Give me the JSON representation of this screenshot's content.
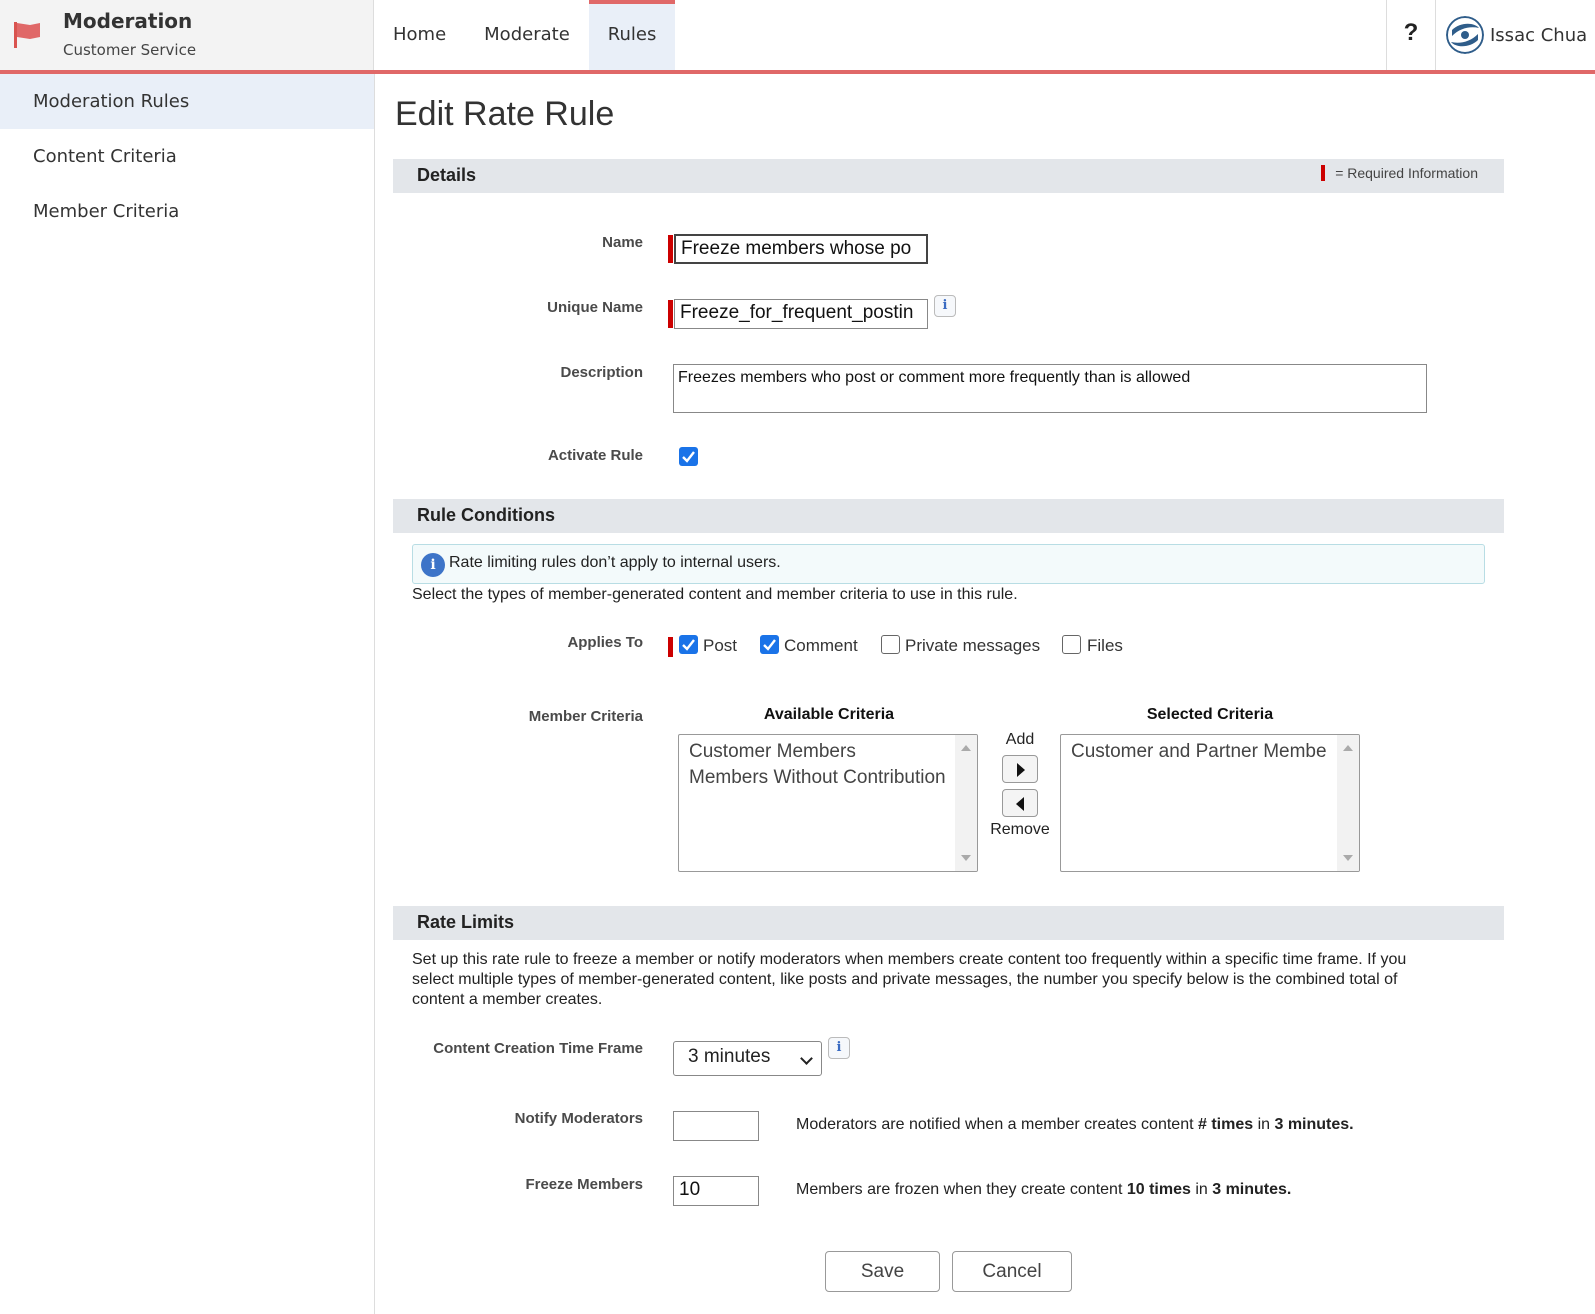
{
  "app": {
    "title": "Moderation",
    "subtitle": "Customer Service"
  },
  "nav": {
    "tabs": [
      {
        "label": "Home"
      },
      {
        "label": "Moderate"
      },
      {
        "label": "Rules",
        "active": true
      }
    ]
  },
  "help_label": "?",
  "user": {
    "name": "Issac Chua"
  },
  "sidebar": {
    "items": [
      {
        "label": "Moderation Rules",
        "active": true
      },
      {
        "label": "Content Criteria"
      },
      {
        "label": "Member Criteria"
      }
    ]
  },
  "page": {
    "title": "Edit Rate Rule"
  },
  "details": {
    "heading": "Details",
    "required_legend": "= Required Information",
    "name_label": "Name",
    "name_value": "Freeze members whose po",
    "unique_name_label": "Unique Name",
    "unique_name_value": "Freeze_for_frequent_postin",
    "description_label": "Description",
    "description_value": "Freezes members who post or comment more frequently than is allowed",
    "activate_label": "Activate Rule",
    "activate_checked": true
  },
  "conditions": {
    "heading": "Rule Conditions",
    "notice": "Rate limiting rules don’t apply to internal users.",
    "instructions": "Select the types of member-generated content and member criteria to use in this rule.",
    "applies_label": "Applies To",
    "applies_options": [
      {
        "label": "Post",
        "checked": true
      },
      {
        "label": "Comment",
        "checked": true
      },
      {
        "label": "Private messages",
        "checked": false
      },
      {
        "label": "Files",
        "checked": false
      }
    ],
    "member_criteria_label": "Member Criteria",
    "available_heading": "Available Criteria",
    "available_options": [
      "Customer Members",
      "Members Without Contribution"
    ],
    "selected_heading": "Selected Criteria",
    "selected_options": [
      "Customer and Partner Membe"
    ],
    "add_label": "Add",
    "remove_label": "Remove"
  },
  "limits": {
    "heading": "Rate Limits",
    "description_line1": "Set up this rate rule to freeze a member or notify moderators when members create content too frequently within a specific time frame. If you",
    "description_line2": "select multiple types of member-generated content, like posts and private messages, the number you specify below is the combined total of",
    "description_line3": "content a member creates.",
    "timeframe_label": "Content Creation Time Frame",
    "timeframe_value": "3 minutes",
    "notify_label": "Notify Moderators",
    "notify_value": "",
    "notify_text_pre": "Moderators are notified when a member creates content ",
    "notify_text_bold1": "# times",
    "notify_text_mid": " in ",
    "notify_text_bold2": "3 minutes.",
    "freeze_label": "Freeze Members",
    "freeze_value": "10",
    "freeze_text_pre": "Members are frozen when they create content ",
    "freeze_text_bold1": "10 times",
    "freeze_text_mid": " in ",
    "freeze_text_bold2": "3 minutes."
  },
  "actions": {
    "save_label": "Save",
    "cancel_label": "Cancel"
  },
  "colors": {
    "accent": "#e06868",
    "active_bg": "#e9eff8",
    "section_bg": "#e3e6ea",
    "required": "#cc0000",
    "checkbox": "#1a73e8"
  },
  "icons": {
    "brand": "flag-icon",
    "info": "info-icon",
    "user": "avatar-icon"
  }
}
